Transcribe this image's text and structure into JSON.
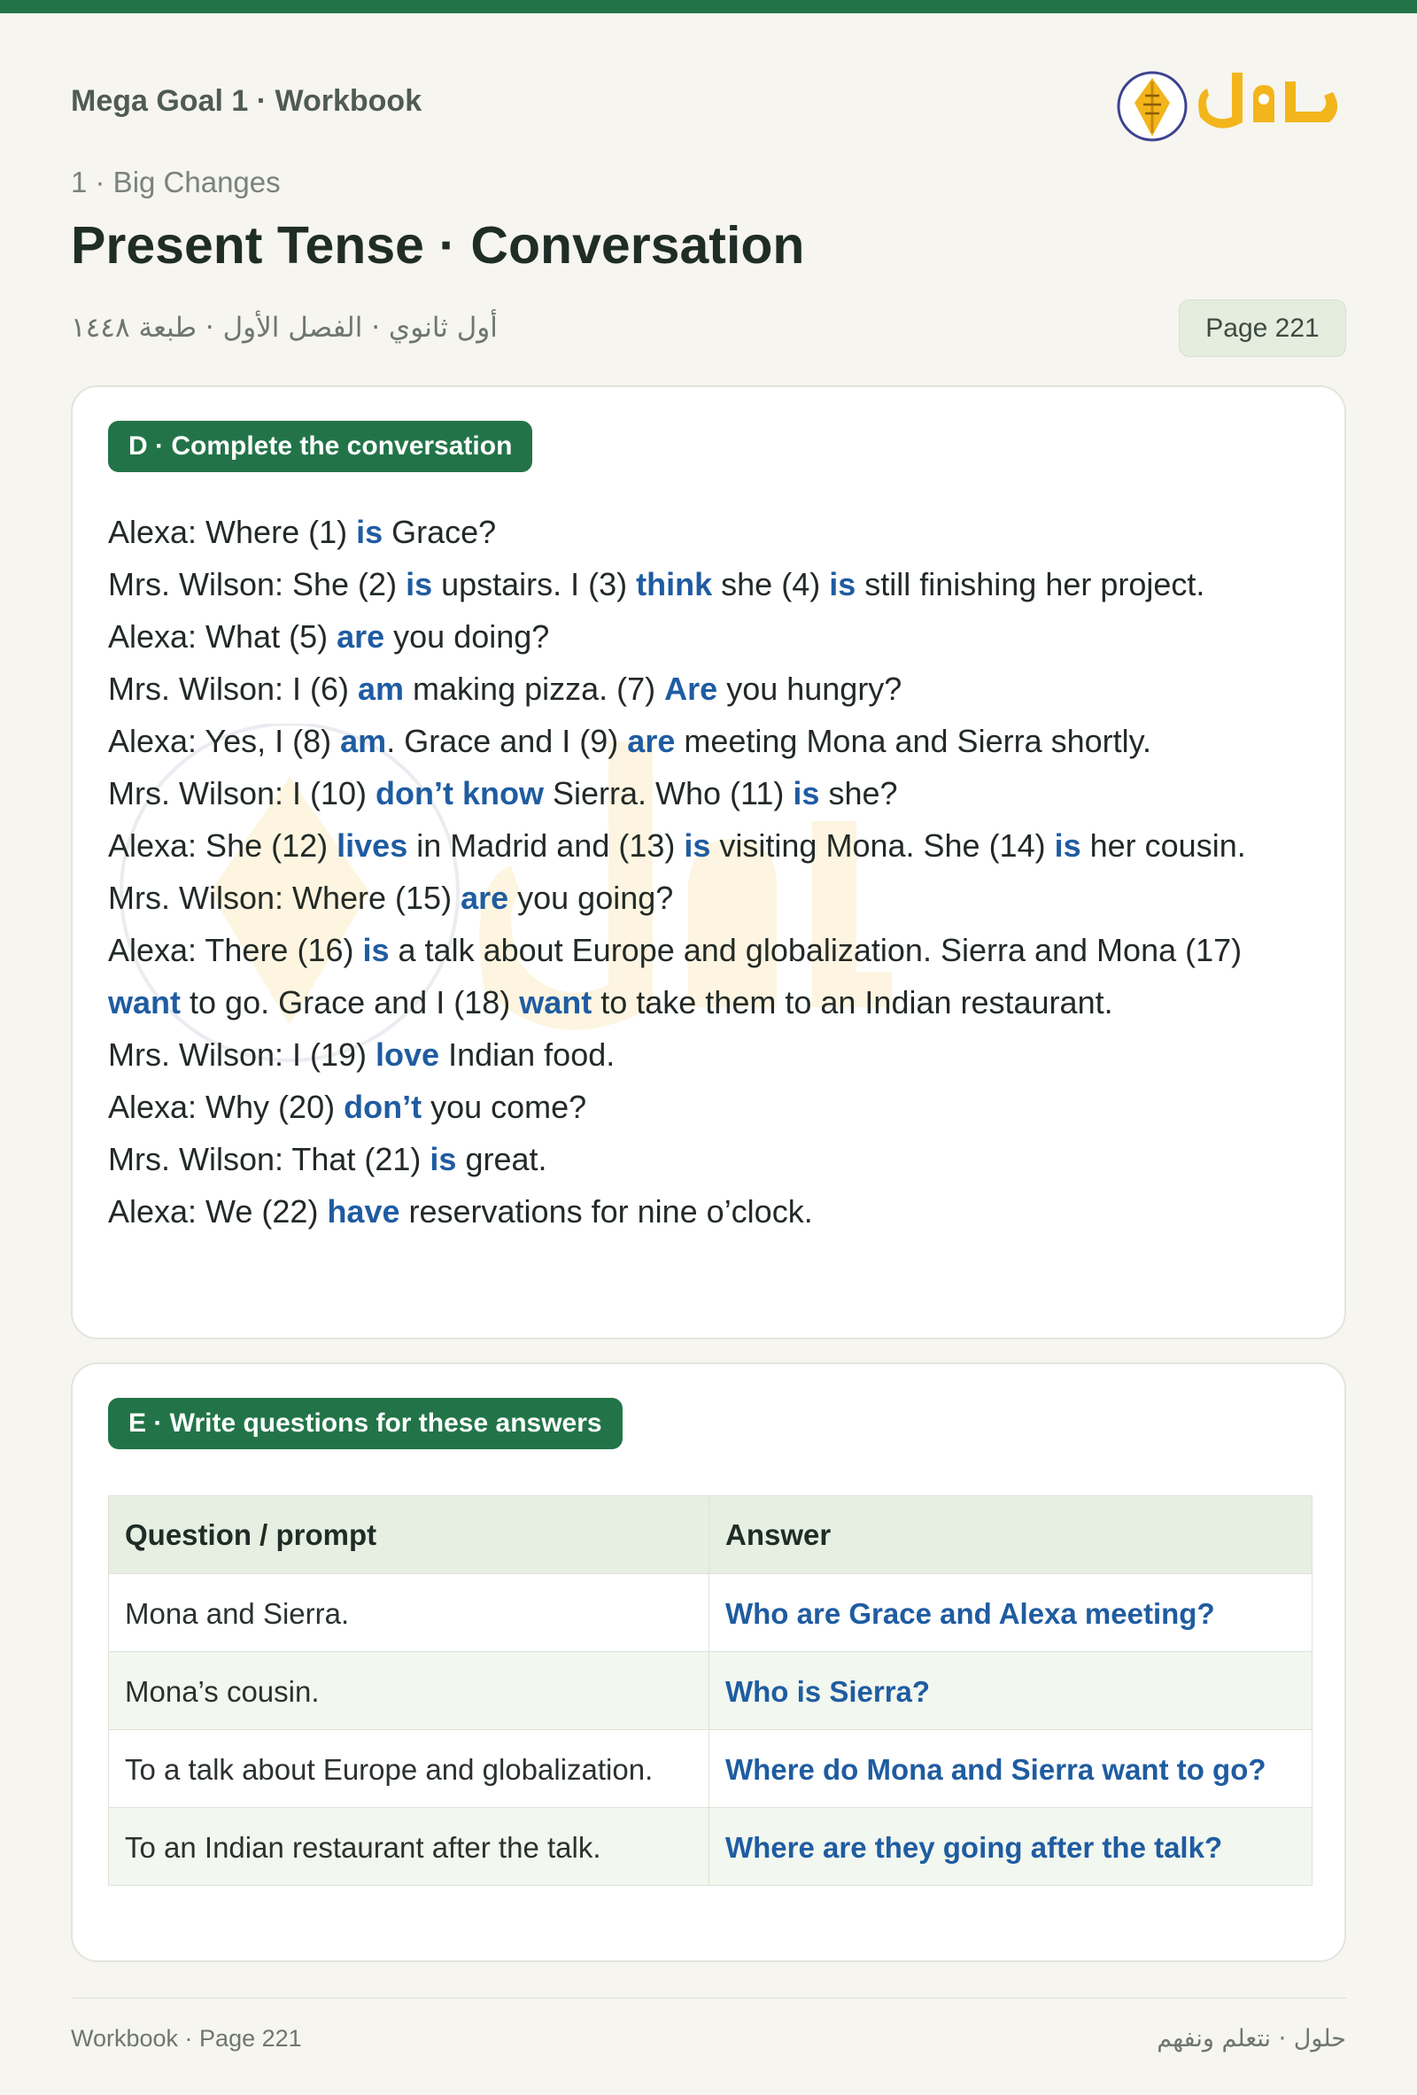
{
  "header": {
    "book": "Mega Goal 1 · Workbook",
    "logo_text": "حلول",
    "unit": "1 · Big Changes",
    "title": "Present Tense · Conversation",
    "arabic_meta": "أول ثانوي · الفصل الأول · طبعة ١٤٤٨",
    "page_badge": "Page 221"
  },
  "section_d": {
    "heading": "D · Complete the conversation",
    "lines": [
      [
        {
          "t": "Alexa: Where (1) "
        },
        {
          "t": "is",
          "a": true
        },
        {
          "t": " Grace?"
        }
      ],
      [
        {
          "t": "Mrs. Wilson: She (2) "
        },
        {
          "t": "is",
          "a": true
        },
        {
          "t": " upstairs. I (3) "
        },
        {
          "t": "think",
          "a": true
        },
        {
          "t": " she (4) "
        },
        {
          "t": "is",
          "a": true
        },
        {
          "t": " still finishing her project."
        }
      ],
      [
        {
          "t": "Alexa: What (5) "
        },
        {
          "t": "are",
          "a": true
        },
        {
          "t": " you doing?"
        }
      ],
      [
        {
          "t": "Mrs. Wilson: I (6) "
        },
        {
          "t": "am",
          "a": true
        },
        {
          "t": " making pizza. (7) "
        },
        {
          "t": "Are",
          "a": true
        },
        {
          "t": " you hungry?"
        }
      ],
      [
        {
          "t": "Alexa: Yes, I (8) "
        },
        {
          "t": "am",
          "a": true
        },
        {
          "t": ". Grace and I (9) "
        },
        {
          "t": "are",
          "a": true
        },
        {
          "t": " meeting Mona and Sierra shortly."
        }
      ],
      [
        {
          "t": "Mrs. Wilson: I (10) "
        },
        {
          "t": "don’t know",
          "a": true
        },
        {
          "t": " Sierra. Who (11) "
        },
        {
          "t": "is",
          "a": true
        },
        {
          "t": " she?"
        }
      ],
      [
        {
          "t": "Alexa: She (12) "
        },
        {
          "t": "lives",
          "a": true
        },
        {
          "t": " in Madrid and (13) "
        },
        {
          "t": "is",
          "a": true
        },
        {
          "t": " visiting Mona. She (14) "
        },
        {
          "t": "is",
          "a": true
        },
        {
          "t": " her cousin."
        }
      ],
      [
        {
          "t": "Mrs. Wilson: Where (15) "
        },
        {
          "t": "are",
          "a": true
        },
        {
          "t": " you going?"
        }
      ],
      [
        {
          "t": "Alexa: There (16) "
        },
        {
          "t": "is",
          "a": true
        },
        {
          "t": " a talk about Europe and globalization. Sierra and Mona (17) "
        },
        {
          "t": "want",
          "a": true
        },
        {
          "t": " to go. Grace and I (18) "
        },
        {
          "t": "want",
          "a": true
        },
        {
          "t": " to take them to an Indian restaurant."
        }
      ],
      [
        {
          "t": "Mrs. Wilson: I (19) "
        },
        {
          "t": "love",
          "a": true
        },
        {
          "t": " Indian food."
        }
      ],
      [
        {
          "t": "Alexa: Why (20) "
        },
        {
          "t": "don’t",
          "a": true
        },
        {
          "t": " you come?"
        }
      ],
      [
        {
          "t": "Mrs. Wilson: That (21) "
        },
        {
          "t": "is",
          "a": true
        },
        {
          "t": " great."
        }
      ],
      [
        {
          "t": "Alexa: We (22) "
        },
        {
          "t": "have",
          "a": true
        },
        {
          "t": " reservations for nine o’clock."
        }
      ]
    ]
  },
  "section_e": {
    "heading": "E · Write questions for these answers",
    "columns": [
      "Question / prompt",
      "Answer"
    ],
    "rows": [
      {
        "prompt": "Mona and Sierra.",
        "answer": "Who are Grace and Alexa meeting?"
      },
      {
        "prompt": "Mona’s cousin.",
        "answer": "Who is Sierra?"
      },
      {
        "prompt": "To a talk about Europe and globalization.",
        "answer": "Where do Mona and Sierra want to go?"
      },
      {
        "prompt": "To an Indian restaurant after the talk.",
        "answer": "Where are they going after the talk?"
      }
    ]
  },
  "footer": {
    "left": "Workbook · Page 221",
    "right": "حلول · نتعلم ونفهم"
  },
  "colors": {
    "brand_green": "#227448",
    "answer_blue": "#1f5ca1",
    "logo_orange": "#f2b51b"
  }
}
